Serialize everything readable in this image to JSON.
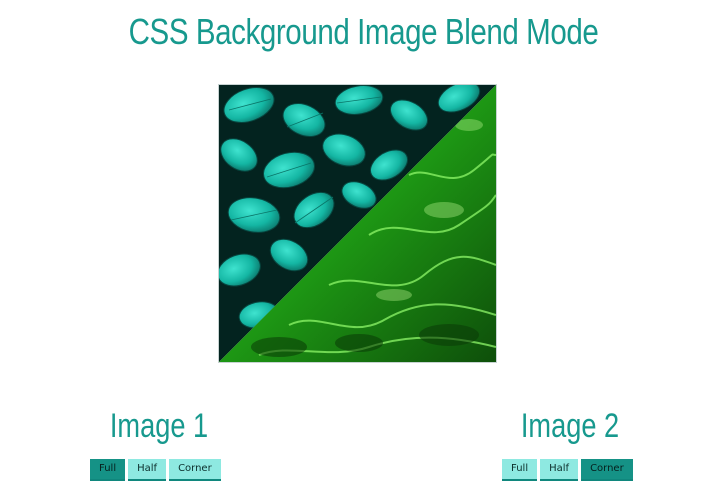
{
  "page": {
    "title": "CSS Background Image Blend Mode"
  },
  "preview": {
    "overlay_colors": [
      "#17c7b4",
      "#38e828"
    ]
  },
  "panels": [
    {
      "heading": "Image 1",
      "buttons": [
        {
          "label": "Full",
          "active": true
        },
        {
          "label": "Half",
          "active": false
        },
        {
          "label": "Corner",
          "active": false
        }
      ]
    },
    {
      "heading": "Image 2",
      "buttons": [
        {
          "label": "Full",
          "active": false
        },
        {
          "label": "Half",
          "active": false
        },
        {
          "label": "Corner",
          "active": true
        }
      ]
    }
  ]
}
